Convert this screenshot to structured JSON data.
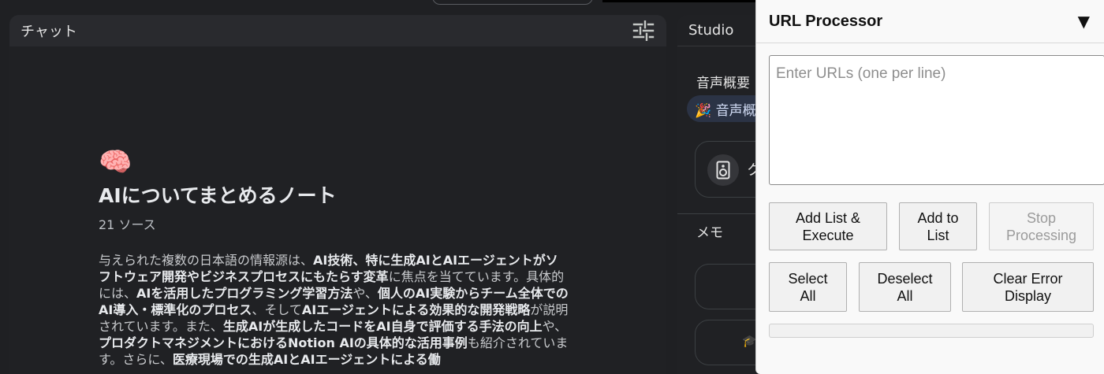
{
  "chat": {
    "title": "チャット",
    "note_title": "AIについてまとめるノート",
    "source_count": "21 ソース",
    "summary": [
      {
        "t": "与えられた複数の日本語の情報源は、",
        "b": false
      },
      {
        "t": "AI技術、特に生成AIとAIエージェントがソフトウェア開発やビジネスプロセスにもたらす変革",
        "b": true
      },
      {
        "t": "に焦点を当てています。具体的には、",
        "b": false
      },
      {
        "t": "AIを活用したプログラミング学習方法",
        "b": true
      },
      {
        "t": "や、",
        "b": false
      },
      {
        "t": "個人のAI実験からチーム全体でのAI導入・標準化のプロセス",
        "b": true
      },
      {
        "t": "、そして",
        "b": false
      },
      {
        "t": "AIエージェントによる効果的な開発戦略",
        "b": true
      },
      {
        "t": "が説明されています。また、",
        "b": false
      },
      {
        "t": "生成AIが生成したコードをAI自身で評価する手法の向上",
        "b": true
      },
      {
        "t": "や、",
        "b": false
      },
      {
        "t": "プロダクトマネジメントにおけるNotion AIの具体的な活用事例",
        "b": true
      },
      {
        "t": "も紹介されています。さらに、",
        "b": false
      },
      {
        "t": "医療現場での生成AIとAIエージェントによる働",
        "b": true
      }
    ]
  },
  "studio": {
    "title": "Studio",
    "audio_overview": "音声概要",
    "audio_chip": "🎉 音声概",
    "card_letter": "ク",
    "memo": "メモ"
  },
  "url_processor": {
    "title": "URL Processor",
    "toggle": "▼",
    "placeholder": "Enter URLs (one per line)",
    "buttons": {
      "add_execute": "Add List &\nExecute",
      "add_to_list": "Add to\nList",
      "stop": "Stop\nProcessing",
      "select_all": "Select\nAll",
      "deselect_all": "Deselect\nAll",
      "clear_error": "Clear Error\nDisplay"
    },
    "progress": 0
  },
  "colors": {
    "background": "#1f2023",
    "panel": "#202124",
    "chip": "#2b3345"
  }
}
